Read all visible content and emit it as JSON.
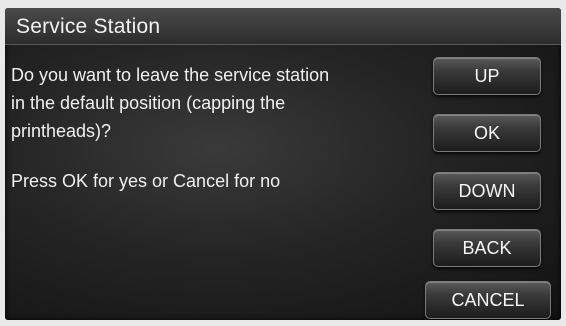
{
  "title_bar": {
    "title": "Service Station"
  },
  "message": {
    "lines": [
      "Do you want to leave the service station",
      "in the default position (capping the",
      "printheads)?"
    ],
    "prompt": "Press OK for yes or Cancel for no"
  },
  "buttons": {
    "up": "UP",
    "ok": "OK",
    "down": "DOWN",
    "back": "BACK",
    "cancel": "CANCEL"
  }
}
